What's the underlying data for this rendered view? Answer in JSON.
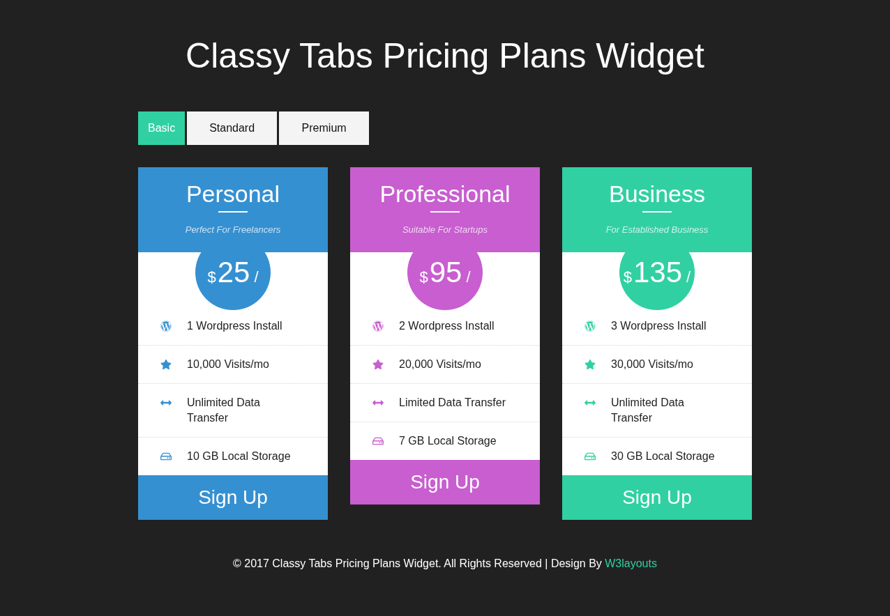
{
  "title": "Classy Tabs Pricing Plans Widget",
  "tabs": [
    {
      "label": "Basic",
      "selected": true
    },
    {
      "label": "Standard",
      "selected": false
    },
    {
      "label": "Premium",
      "selected": false
    }
  ],
  "plans": [
    {
      "name": "Personal",
      "tagline": "Perfect For Freelancers",
      "color": "#3590d1",
      "currency": "$",
      "price": "25",
      "per": "/",
      "features": [
        {
          "kind": "wordpress",
          "text": "1 Wordpress Install"
        },
        {
          "kind": "star",
          "text": "10,000 Visits/mo"
        },
        {
          "kind": "transfer",
          "text": "Unlimited Data Transfer"
        },
        {
          "kind": "storage",
          "text": "10 GB Local Storage"
        }
      ],
      "button": "Sign Up"
    },
    {
      "name": "Professional",
      "tagline": "Suitable For Startups",
      "color": "#c85ecf",
      "currency": "$",
      "price": "95",
      "per": "/",
      "features": [
        {
          "kind": "wordpress",
          "text": "2 Wordpress Install"
        },
        {
          "kind": "star",
          "text": "20,000 Visits/mo"
        },
        {
          "kind": "transfer",
          "text": "Limited Data Transfer"
        },
        {
          "kind": "storage",
          "text": "7 GB Local Storage"
        }
      ],
      "button": "Sign Up"
    },
    {
      "name": "Business",
      "tagline": "For Established Business",
      "color": "#31d0a2",
      "currency": "$",
      "price": "135",
      "per": "/",
      "features": [
        {
          "kind": "wordpress",
          "text": "3 Wordpress Install"
        },
        {
          "kind": "star",
          "text": "30,000 Visits/mo"
        },
        {
          "kind": "transfer",
          "text": "Unlimited Data Transfer"
        },
        {
          "kind": "storage",
          "text": "30 GB Local Storage"
        }
      ],
      "button": "Sign Up"
    }
  ],
  "footer": {
    "text": "© 2017 Classy Tabs Pricing Plans Widget. All Rights Reserved | Design By",
    "link": "W3layouts"
  }
}
